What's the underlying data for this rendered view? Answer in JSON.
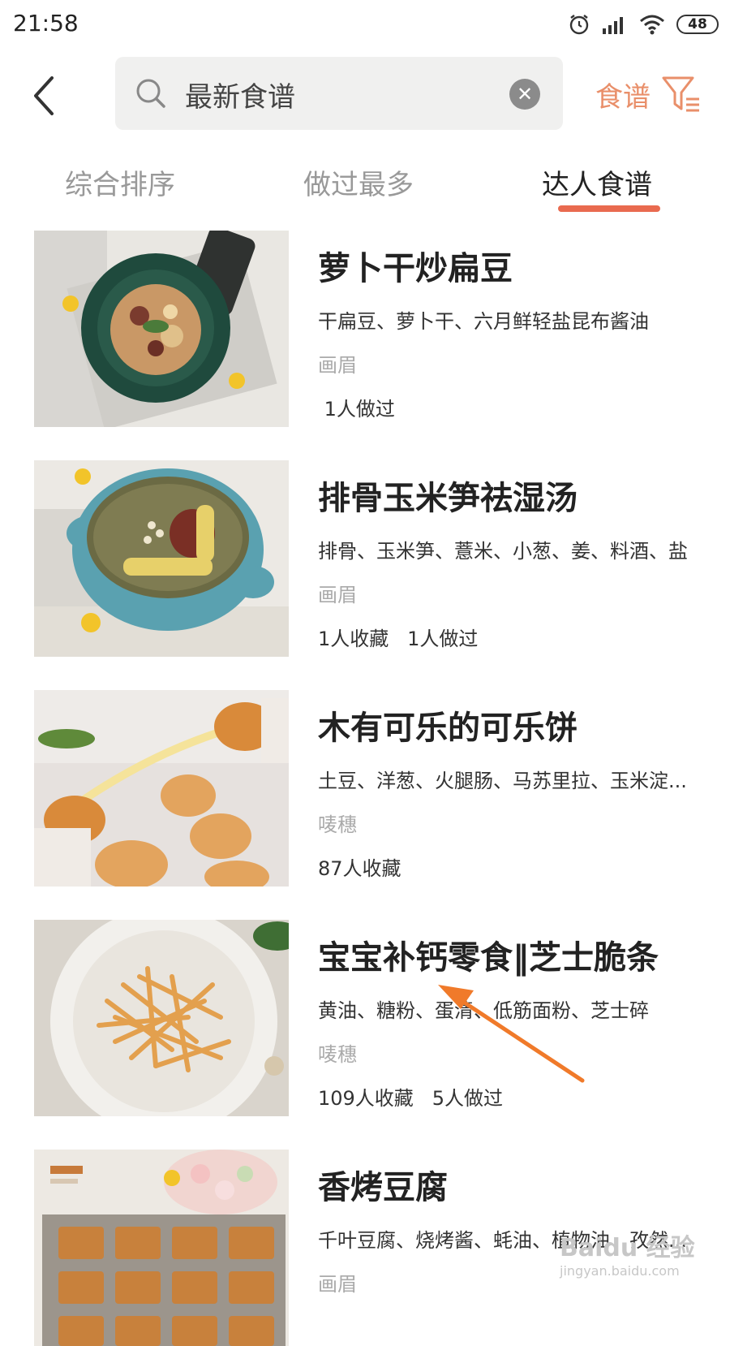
{
  "status_bar": {
    "time": "21:58",
    "battery": "48"
  },
  "search": {
    "query": "最新食谱"
  },
  "filter": {
    "label": "食谱"
  },
  "tabs": [
    {
      "label": "综合排序",
      "active": false
    },
    {
      "label": "做过最多",
      "active": false
    },
    {
      "label": "达人食谱",
      "active": true
    }
  ],
  "recipes": [
    {
      "title": "萝卜干炒扁豆",
      "ingredients": "干扁豆、萝卜干、六月鲜轻盐昆布酱油",
      "author": "画眉",
      "stats": " 1人做过"
    },
    {
      "title": "排骨玉米笋祛湿汤",
      "ingredients": "排骨、玉米笋、薏米、小葱、姜、料酒、盐",
      "author": "画眉",
      "stats": "1人收藏   1人做过"
    },
    {
      "title": " 木有可乐的可乐饼",
      "ingredients": "土豆、洋葱、火腿肠、马苏里拉、玉米淀...",
      "author": "唛穗",
      "stats": "87人收藏"
    },
    {
      "title": "宝宝补钙零食‖芝士脆条",
      "ingredients": "黄油、糖粉、蛋清、低筋面粉、芝士碎",
      "author": "唛穗",
      "stats": "109人收藏   5人做过"
    },
    {
      "title": "香烤豆腐",
      "ingredients": "千叶豆腐、烧烤酱、蚝油、植物油、孜然...",
      "author": "画眉",
      "stats": ""
    }
  ],
  "watermark": {
    "main": "Baidu 经验",
    "sub": "jingyan.baidu.com"
  },
  "colors": {
    "accent": "#e96a4f",
    "filter": "#e98f6a",
    "arrow": "#f07a2a"
  }
}
